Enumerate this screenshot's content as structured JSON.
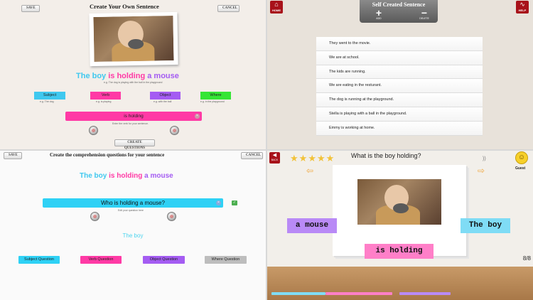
{
  "q1": {
    "save": "SAVE",
    "cancel": "CANCEL",
    "title": "Create Your Own Sentence",
    "sentence": {
      "subject": "The boy",
      "verb": "is holding",
      "object": "a mouse"
    },
    "sentence_hint": "e.g. The dog is playing with the ball in the playground",
    "chips": [
      {
        "label": "Subject",
        "hint": "e.g. The dog"
      },
      {
        "label": "Verb",
        "hint": "e.g. is playing"
      },
      {
        "label": "Object",
        "hint": "e.g. with the ball"
      },
      {
        "label": "Where",
        "hint": "e.g. in the playground"
      }
    ],
    "input_value": "is holding",
    "input_hint": "Enter the verb for your sentence.",
    "create_questions": "CREATE QUESTIONS",
    "colors": {
      "subject": "#3fc8ef",
      "verb": "#ff3aa5",
      "object": "#a45cf2",
      "where": "#35e535"
    }
  },
  "q2": {
    "home": "HOME",
    "help": "HELP",
    "title": "Self Created Sentence",
    "add_label": "ADD",
    "delete_label": "DELETE",
    "sentences": [
      "They went to the movie.",
      "We are at school.",
      "The kids are running.",
      "We are eating in the resturant.",
      "The dog is running at the playground.",
      "Stella is playing with a ball in the playground.",
      "Emmy is working at home."
    ]
  },
  "q3": {
    "save": "SAVE",
    "cancel": "CANCEL",
    "title": "Create the comprehension questions for your sentence",
    "sentence": {
      "subject": "The boy",
      "verb": "is holding",
      "object": "a mouse"
    },
    "question_value": "Who is holding a mouse?",
    "question_hint": "Edit your question here",
    "answer": "The boy",
    "buttons": [
      "Subject Question",
      "Verb Question",
      "Object Question",
      "Where Question"
    ]
  },
  "q4": {
    "back": "BACK",
    "stars": 5,
    "question": "What is the boy holding?",
    "guest": "Guest",
    "tiles": [
      "a mouse",
      "The boy",
      "is holding"
    ],
    "counter": "8/8"
  }
}
